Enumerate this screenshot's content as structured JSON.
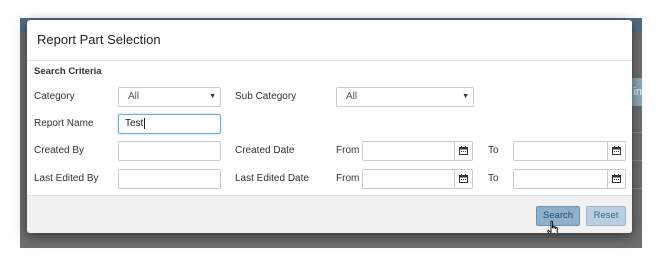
{
  "background": {
    "side_tab_fragment": "in"
  },
  "modal": {
    "title": "Report Part Selection",
    "section_title": "Search Criteria",
    "fields": {
      "category": {
        "label": "Category",
        "value": "All"
      },
      "sub_category": {
        "label": "Sub Category",
        "value": "All"
      },
      "report_name": {
        "label": "Report Name",
        "value": "Test"
      },
      "created_by": {
        "label": "Created By",
        "value": ""
      },
      "created_date": {
        "label": "Created Date",
        "from_label": "From",
        "to_label": "To",
        "from_value": "",
        "to_value": ""
      },
      "last_edited_by": {
        "label": "Last Edited By",
        "value": ""
      },
      "last_edited_date": {
        "label": "Last Edited Date",
        "from_label": "From",
        "to_label": "To",
        "from_value": "",
        "to_value": ""
      }
    },
    "buttons": {
      "search": "Search",
      "reset": "Reset"
    }
  },
  "icons": {
    "dropdown": "caret-down-icon",
    "calendar": "calendar-icon",
    "cursor": "hand-pointer-icon"
  },
  "colors": {
    "search_button": "#8fb0ca",
    "reset_button": "#b9cfdf",
    "focus_border": "#66afe9",
    "footer": "#f1f1f1"
  }
}
